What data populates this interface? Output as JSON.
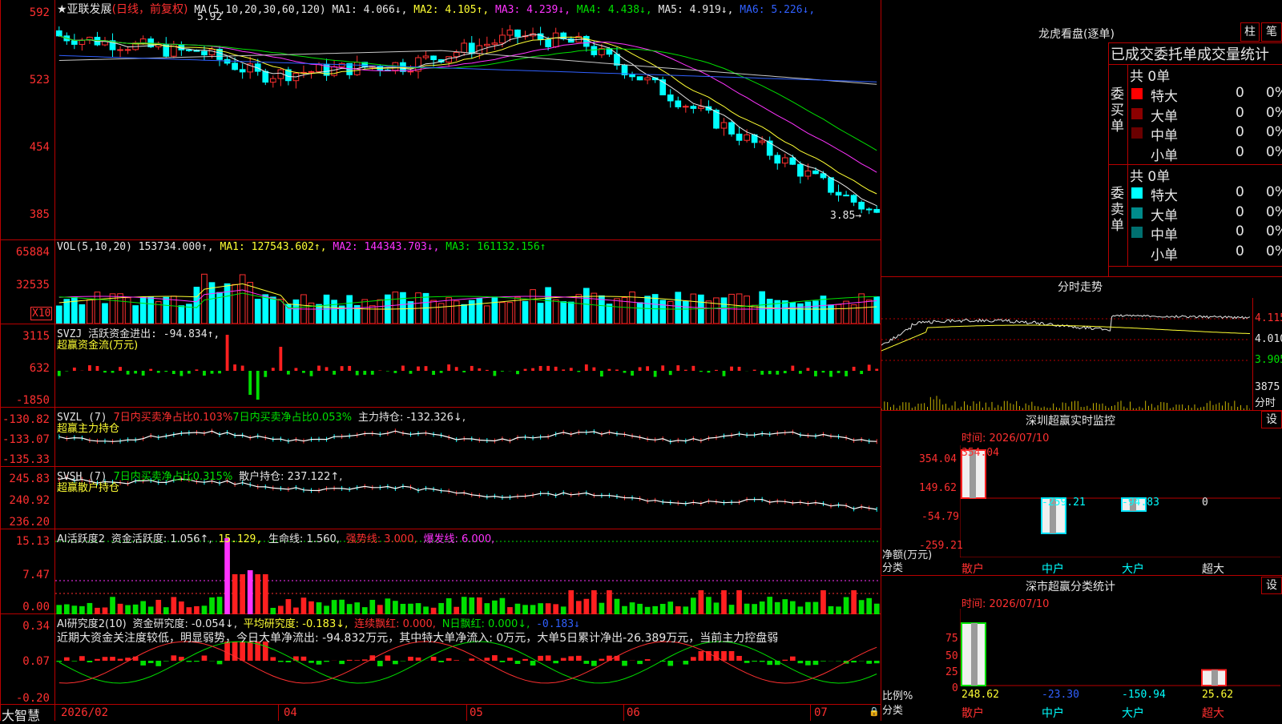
{
  "stock": {
    "name": "★亚联发展",
    "period": "(日线，前复权)",
    "ma_params": "MA(5,10,20,30,60,120)",
    "ma": [
      {
        "label": "MA1:",
        "value": "4.066",
        "arrow": "↓",
        "color": "#e6e6e6"
      },
      {
        "label": "MA2:",
        "value": "4.105",
        "arrow": "↑",
        "color": "#ffff33"
      },
      {
        "label": "MA3:",
        "value": "4.239",
        "arrow": "↓",
        "color": "#ff33ff"
      },
      {
        "label": "MA4:",
        "value": "4.438",
        "arrow": "↓",
        "color": "#00e000"
      },
      {
        "label": "MA5:",
        "value": "4.919",
        "arrow": "↓",
        "color": "#e6e6e6"
      },
      {
        "label": "MA6:",
        "value": "5.226",
        "arrow": "↓",
        "color": "#3060ff"
      }
    ],
    "high_marker": "5.92",
    "low_marker": "3.85→",
    "price_axis": [
      "592",
      "523",
      "454",
      "385"
    ]
  },
  "vol": {
    "label": "VOL(5,10,20)",
    "value": "153734.000↑,",
    "ma1": "MA1: 127543.602↑,",
    "ma2": "MA2: 144343.703↓,",
    "ma3": "MA3: 161132.156↑",
    "axis": [
      "65884",
      "32535"
    ],
    "unit": "X10"
  },
  "svzj": {
    "label": "SVZJ  活跃资金进出: -94.834↑,",
    "title": "超赢资金流(万元)",
    "axis": [
      "3115",
      "632",
      "-1850"
    ]
  },
  "svzl": {
    "label": "SVZL (7)",
    "a": "7日内买卖净占比0.103%",
    "b": "7日内买卖净占比0.053%",
    "c": "主力持仓: -132.326↓,",
    "title": "超赢主力持仓",
    "axis": [
      "-130.82",
      "-133.07",
      "-135.33"
    ]
  },
  "svsh": {
    "label": "SVSH (7)",
    "a": "7日内买卖净占比0.315%",
    "c": "散户持仓: 237.122↑,",
    "title": "超赢散户持仓",
    "axis": [
      "245.83",
      "240.92",
      "236.20"
    ]
  },
  "ai2": {
    "label": "AI活跃度2",
    "a": "资金活跃度: 1.056↑,",
    "b": "15.129,",
    "c": "生命线: 1.560,",
    "d": "强势线: 3.000,",
    "e": "爆发线: 6.000,",
    "axis": [
      "15.13",
      "7.47",
      "0.00"
    ]
  },
  "ai_research": {
    "label": "AI研究度2(10)",
    "a": "资金研究度: -0.054↓,",
    "b": "平均研究度: -0.183↓,",
    "c": "连续飘红: 0.000,",
    "d": "N日飘红: 0.000↓,",
    "e": "-0.183↓",
    "comment": "近期大资金关注度较低，明显弱势，今日大单净流出: -94.832万元，其中特大单净流入: 0万元，大单5日累计净出-26.389万元，当前主力控盘弱",
    "axis": [
      "0.34",
      "0.07",
      "-0.20"
    ]
  },
  "xaxis": {
    "brand": "大智慧",
    "labels": [
      "2026/02",
      "04",
      "05",
      "06",
      "07"
    ]
  },
  "right": {
    "longhu_title": "龙虎看盘(逐单)",
    "btn_zhu": "柱",
    "btn_bi": "笔",
    "stats_title": "已成交委托单成交量统计",
    "buy_side": "委买单",
    "sell_side": "委卖单",
    "buy_total": "共 0单",
    "sell_total": "共 0单",
    "buy_rows": [
      {
        "name": "特大",
        "v": "0",
        "p": "0%",
        "color": "#ff0000"
      },
      {
        "name": "大单",
        "v": "0",
        "p": "0%",
        "color": "#8b0000"
      },
      {
        "name": "中单",
        "v": "0",
        "p": "0%",
        "color": "#6a0000"
      },
      {
        "name": "小单",
        "v": "0",
        "p": "0%",
        "color": "#000000"
      }
    ],
    "sell_rows": [
      {
        "name": "特大",
        "v": "0",
        "p": "0%",
        "color": "#00ffff"
      },
      {
        "name": "大单",
        "v": "0",
        "p": "0%",
        "color": "#008b8b"
      },
      {
        "name": "中单",
        "v": "0",
        "p": "0%",
        "color": "#007070"
      },
      {
        "name": "小单",
        "v": "0",
        "p": "0%",
        "color": "#000000"
      }
    ],
    "intraday_title": "分时走势",
    "intraday_axis": [
      "4.115",
      "4.010",
      "3.905"
    ],
    "intraday_vol": "3875",
    "intraday_vol_unit": "分时",
    "sz_monitor_title": "深圳超赢实时监控",
    "sz_monitor_btn": "设",
    "sz_time": "时间: 2026/07/10",
    "sz_axis": [
      "354.04",
      "149.62",
      "-54.79",
      "-259.21"
    ],
    "sz_unit": "净额(万元)",
    "sz_class": "分类",
    "sz_bars": [
      {
        "name": "散户",
        "value": "354.04",
        "num": 354.04
      },
      {
        "name": "中户",
        "value": "-259.21",
        "num": -259.21
      },
      {
        "name": "大户",
        "value": "-94.83",
        "num": -94.83
      },
      {
        "name": "超大",
        "value": "0",
        "num": 0
      }
    ],
    "cls_title": "深市超赢分类统计",
    "cls_btn": "设",
    "cls_time": "时间: 2026/07/10",
    "cls_axis": [
      "75",
      "50",
      "25",
      "0"
    ],
    "cls_unit": "比例%",
    "cls_class": "分类",
    "cls_bars": [
      {
        "name": "散户",
        "value": "248.62",
        "pct": 100
      },
      {
        "name": "中户",
        "value": "-23.30",
        "pct": 0
      },
      {
        "name": "大户",
        "value": "-150.94",
        "pct": 0
      },
      {
        "name": "超大",
        "value": "25.62",
        "pct": 25
      }
    ]
  }
}
